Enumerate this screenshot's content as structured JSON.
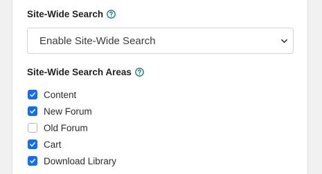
{
  "site_wide_search": {
    "label": "Site-Wide Search",
    "help_icon": "question-circle-icon",
    "select": {
      "selected_value": "Enable Site-Wide Search",
      "chevron_icon": "chevron-down-icon"
    }
  },
  "search_areas": {
    "label": "Site-Wide Search Areas",
    "help_icon": "question-circle-icon",
    "items": [
      {
        "label": "Content",
        "checked": true
      },
      {
        "label": "New Forum",
        "checked": true
      },
      {
        "label": "Old Forum",
        "checked": false
      },
      {
        "label": "Cart",
        "checked": true
      },
      {
        "label": "Download Library",
        "checked": true
      }
    ]
  },
  "colors": {
    "accent": "#0d6efd",
    "help_icon": "#0e7c86",
    "text": "#1f1f1f"
  }
}
